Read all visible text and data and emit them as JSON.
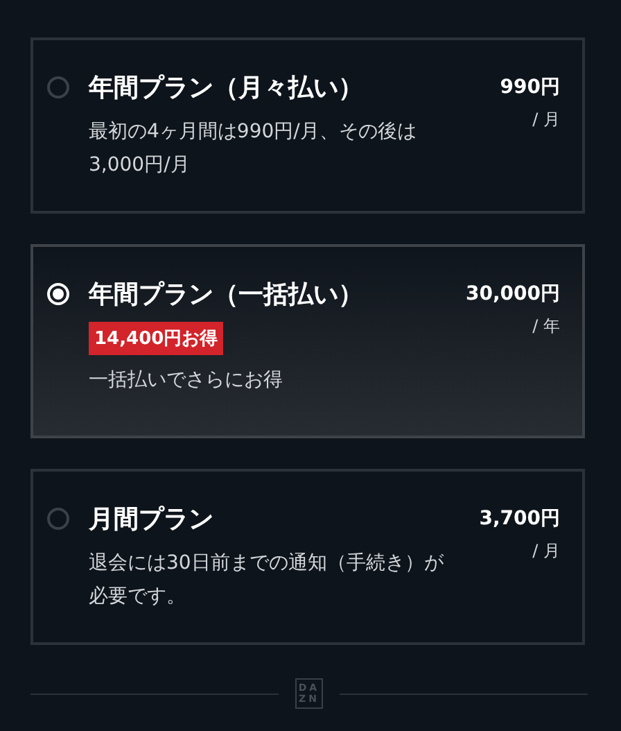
{
  "plans": [
    {
      "title": "年間プラン（月々払い）",
      "selected": false,
      "price": "990円",
      "unit": "/ 月",
      "description": "最初の4ヶ月間は990円/月、その後は3,000円/月"
    },
    {
      "title": "年間プラン（一括払い）",
      "selected": true,
      "badge": "14,400円お得",
      "price": "30,000円",
      "unit": "/ 年",
      "description": "一括払いでさらにお得"
    },
    {
      "title": "月間プラン",
      "selected": false,
      "price": "3,700円",
      "unit": "/ 月",
      "description": "退会には30日前までの通知（手続き）が必要です。"
    }
  ],
  "logo": "DAZN"
}
